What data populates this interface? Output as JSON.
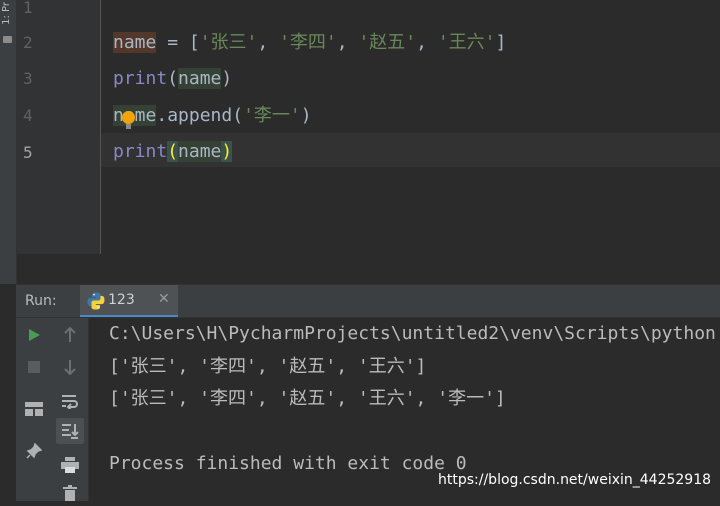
{
  "project_panel": {
    "label": "1: Pr"
  },
  "editor": {
    "line_numbers": [
      "1",
      "2",
      "3",
      "4",
      "5"
    ],
    "code": {
      "l2": {
        "var": "name",
        "op": " = ",
        "open": "[",
        "s1": "'张三'",
        "sep": ", ",
        "s2": "'李四'",
        "s3": "'赵五'",
        "s4": "'王六'",
        "close": "]"
      },
      "l3": {
        "fn": "print",
        "open": "(",
        "arg": "name",
        "close": ")"
      },
      "l4": {
        "var": "name",
        "dot": ".",
        "method": "append",
        "open": "(",
        "arg": "'李一'",
        "close": ")"
      },
      "l5": {
        "fn": "print",
        "open": "(",
        "arg": "name",
        "close": ")"
      }
    }
  },
  "run_panel": {
    "label": "Run:",
    "tab": {
      "name": "123",
      "icon": "python-icon"
    }
  },
  "console": {
    "lines": [
      "C:\\Users\\H\\PycharmProjects\\untitled2\\venv\\Scripts\\python",
      "['张三', '李四', '赵五', '王六']",
      "['张三', '李四', '赵五', '王六', '李一']",
      "",
      "Process finished with exit code 0"
    ]
  },
  "watermark": "https://blog.csdn.net/weixin_44252918",
  "colors": {
    "keyword": "#8888c6",
    "string": "#6a8759",
    "brace_match": "#ffef28",
    "run_green": "#499c54"
  }
}
